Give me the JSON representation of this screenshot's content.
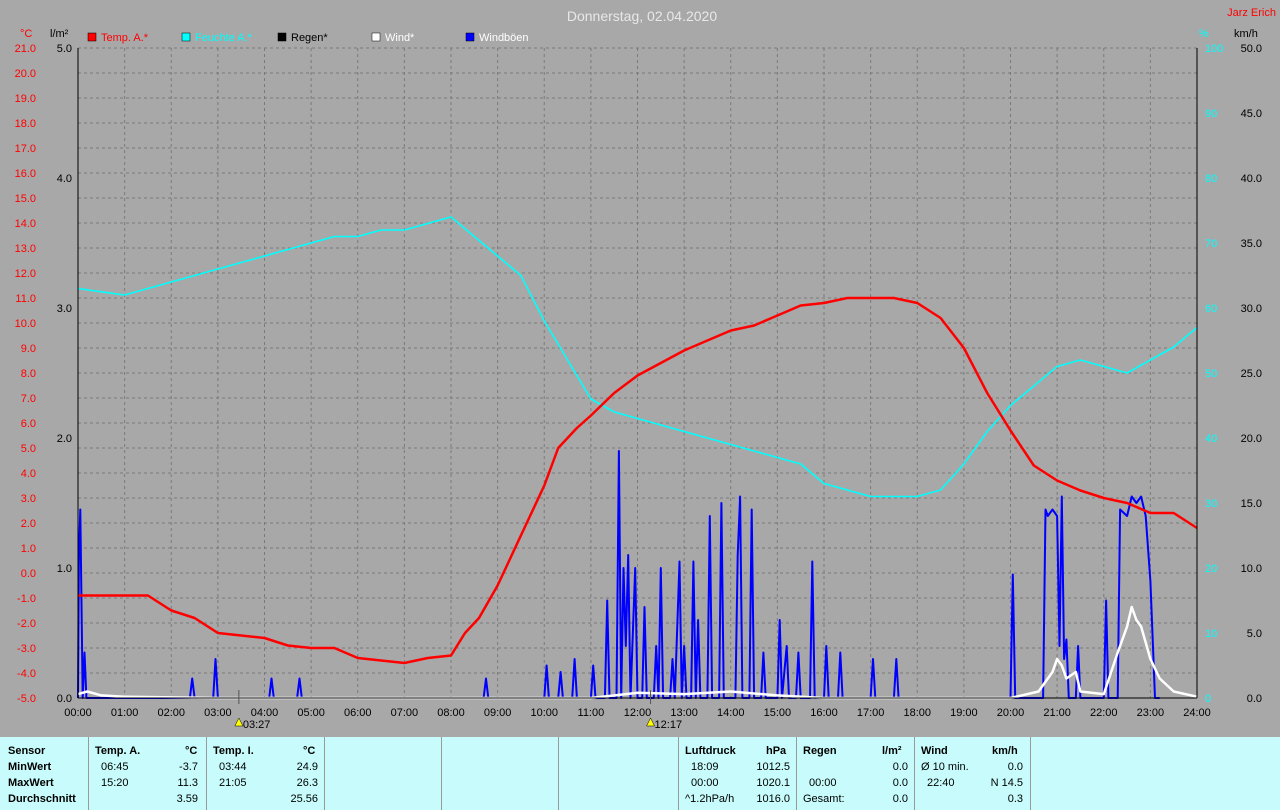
{
  "header": {
    "title": "Donnerstag, 02.04.2020",
    "author": "Jarz Erich"
  },
  "axes": {
    "left_temp_unit": "°C",
    "left_rain_unit": "l/m²",
    "right_pct_unit": "%",
    "right_wind_unit": "km/h"
  },
  "legend": [
    {
      "name": "Temp. A.*",
      "color": "#ff0000"
    },
    {
      "name": "Feuchte A.*",
      "color": "#00ffff"
    },
    {
      "name": "Regen*",
      "color": "#000000"
    },
    {
      "name": "Wind*",
      "color": "#ffffff"
    },
    {
      "name": "Windböen",
      "color": "#0000ff"
    }
  ],
  "chart_data": {
    "type": "line",
    "x_ticks": [
      "00:00",
      "01:00",
      "02:00",
      "03:00",
      "04:00",
      "05:00",
      "06:00",
      "07:00",
      "08:00",
      "09:00",
      "10:00",
      "11:00",
      "12:00",
      "13:00",
      "14:00",
      "15:00",
      "16:00",
      "17:00",
      "18:00",
      "19:00",
      "20:00",
      "21:00",
      "22:00",
      "23:00",
      "24:00"
    ],
    "temp_ticks": [
      "21.0",
      "20.0",
      "19.0",
      "18.0",
      "17.0",
      "16.0",
      "15.0",
      "14.0",
      "13.0",
      "12.0",
      "11.0",
      "10.0",
      "9.0",
      "8.0",
      "7.0",
      "6.0",
      "5.0",
      "4.0",
      "3.0",
      "2.0",
      "1.0",
      "0.0",
      "-1.0",
      "-2.0",
      "-3.0",
      "-4.0",
      "-5.0"
    ],
    "rain_ticks": [
      "5.0",
      "4.0",
      "3.0",
      "2.0",
      "1.0",
      "0.0"
    ],
    "pct_ticks": [
      "100",
      "90",
      "80",
      "70",
      "60",
      "50",
      "40",
      "30",
      "20",
      "10",
      "0"
    ],
    "wind_ticks": [
      "50.0",
      "45.0",
      "40.0",
      "35.0",
      "30.0",
      "25.0",
      "20.0",
      "15.0",
      "10.0",
      "5.0",
      "0.0"
    ],
    "ranges": {
      "temp": [
        -5,
        21
      ],
      "rain": [
        0,
        5
      ],
      "pct": [
        0,
        100
      ],
      "wind": [
        0,
        50
      ],
      "hours": [
        0,
        24
      ]
    },
    "markers": [
      {
        "label": "03:27",
        "hour": 3.45
      },
      {
        "label": "12:17",
        "hour": 12.28
      }
    ],
    "series": [
      {
        "name": "Temp. A.*",
        "color": "#ff0000",
        "axis": "temp",
        "points": [
          [
            0,
            -0.9
          ],
          [
            1,
            -0.9
          ],
          [
            1.5,
            -0.9
          ],
          [
            2,
            -1.5
          ],
          [
            2.5,
            -1.8
          ],
          [
            3,
            -2.4
          ],
          [
            3.5,
            -2.5
          ],
          [
            4,
            -2.6
          ],
          [
            4.5,
            -2.9
          ],
          [
            5,
            -3.0
          ],
          [
            5.5,
            -3.0
          ],
          [
            6,
            -3.4
          ],
          [
            6.5,
            -3.5
          ],
          [
            7,
            -3.6
          ],
          [
            7.5,
            -3.4
          ],
          [
            8,
            -3.3
          ],
          [
            8.3,
            -2.4
          ],
          [
            8.6,
            -1.8
          ],
          [
            9,
            -0.5
          ],
          [
            9.5,
            1.5
          ],
          [
            10,
            3.5
          ],
          [
            10.3,
            5.0
          ],
          [
            10.7,
            5.8
          ],
          [
            11,
            6.3
          ],
          [
            11.5,
            7.2
          ],
          [
            12,
            7.9
          ],
          [
            12.5,
            8.4
          ],
          [
            13,
            8.9
          ],
          [
            13.5,
            9.3
          ],
          [
            14,
            9.7
          ],
          [
            14.5,
            9.9
          ],
          [
            15,
            10.3
          ],
          [
            15.5,
            10.7
          ],
          [
            16,
            10.8
          ],
          [
            16.5,
            11.0
          ],
          [
            17,
            11.0
          ],
          [
            17.5,
            11.0
          ],
          [
            18,
            10.8
          ],
          [
            18.5,
            10.2
          ],
          [
            19,
            9.0
          ],
          [
            19.5,
            7.2
          ],
          [
            20,
            5.7
          ],
          [
            20.5,
            4.3
          ],
          [
            21,
            3.7
          ],
          [
            21.5,
            3.3
          ],
          [
            22,
            3.0
          ],
          [
            22.5,
            2.8
          ],
          [
            23,
            2.4
          ],
          [
            23.5,
            2.4
          ],
          [
            24,
            1.8
          ]
        ]
      },
      {
        "name": "Feuchte A.*",
        "color": "#00ffff",
        "axis": "pct",
        "points": [
          [
            0,
            63
          ],
          [
            0.5,
            62.5
          ],
          [
            1,
            62
          ],
          [
            1.5,
            63
          ],
          [
            2,
            64
          ],
          [
            2.5,
            65
          ],
          [
            3,
            66
          ],
          [
            3.5,
            67
          ],
          [
            4,
            68
          ],
          [
            4.5,
            69
          ],
          [
            5,
            70
          ],
          [
            5.5,
            71
          ],
          [
            6,
            71
          ],
          [
            6.5,
            72
          ],
          [
            7,
            72
          ],
          [
            7.5,
            73
          ],
          [
            8,
            74
          ],
          [
            8.5,
            71
          ],
          [
            9,
            68
          ],
          [
            9.5,
            65
          ],
          [
            10,
            58
          ],
          [
            10.5,
            52
          ],
          [
            11,
            46
          ],
          [
            11.5,
            44
          ],
          [
            12,
            43
          ],
          [
            12.5,
            42
          ],
          [
            13,
            41
          ],
          [
            13.5,
            40
          ],
          [
            14,
            39
          ],
          [
            14.5,
            38
          ],
          [
            15,
            37
          ],
          [
            15.5,
            36
          ],
          [
            16,
            33
          ],
          [
            16.5,
            32
          ],
          [
            17,
            31
          ],
          [
            17.5,
            31
          ],
          [
            18,
            31
          ],
          [
            18.5,
            32
          ],
          [
            19,
            36
          ],
          [
            19.5,
            41
          ],
          [
            20,
            45
          ],
          [
            20.5,
            48
          ],
          [
            21,
            51
          ],
          [
            21.5,
            52
          ],
          [
            22,
            51
          ],
          [
            22.5,
            50
          ],
          [
            23,
            52
          ],
          [
            23.5,
            54
          ],
          [
            24,
            57
          ]
        ]
      },
      {
        "name": "Windböen",
        "color": "#0000ff",
        "axis": "wind",
        "points": [
          [
            0,
            0
          ],
          [
            0.02,
            11
          ],
          [
            0.05,
            14.5
          ],
          [
            0.1,
            0
          ],
          [
            0.14,
            3.5
          ],
          [
            0.18,
            0
          ],
          [
            2.4,
            0
          ],
          [
            2.45,
            1.5
          ],
          [
            2.5,
            0
          ],
          [
            2.9,
            0
          ],
          [
            2.95,
            3
          ],
          [
            3.0,
            0
          ],
          [
            4.1,
            0
          ],
          [
            4.15,
            1.5
          ],
          [
            4.2,
            0
          ],
          [
            4.7,
            0
          ],
          [
            4.75,
            1.5
          ],
          [
            4.8,
            0
          ],
          [
            8.7,
            0
          ],
          [
            8.75,
            1.5
          ],
          [
            8.8,
            0
          ],
          [
            10.0,
            0
          ],
          [
            10.05,
            2.5
          ],
          [
            10.1,
            0
          ],
          [
            10.3,
            0
          ],
          [
            10.35,
            2
          ],
          [
            10.4,
            0
          ],
          [
            10.6,
            0
          ],
          [
            10.65,
            3
          ],
          [
            10.7,
            0
          ],
          [
            11.0,
            0
          ],
          [
            11.05,
            2.5
          ],
          [
            11.1,
            0
          ],
          [
            11.3,
            0
          ],
          [
            11.35,
            7.5
          ],
          [
            11.4,
            0
          ],
          [
            11.55,
            0
          ],
          [
            11.6,
            19
          ],
          [
            11.65,
            0
          ],
          [
            11.7,
            10
          ],
          [
            11.75,
            4
          ],
          [
            11.8,
            11
          ],
          [
            11.85,
            0
          ],
          [
            11.95,
            10
          ],
          [
            12.0,
            0
          ],
          [
            12.1,
            0
          ],
          [
            12.15,
            7
          ],
          [
            12.2,
            0
          ],
          [
            12.35,
            0
          ],
          [
            12.4,
            4
          ],
          [
            12.45,
            0
          ],
          [
            12.5,
            10
          ],
          [
            12.55,
            0
          ],
          [
            12.7,
            0
          ],
          [
            12.75,
            3
          ],
          [
            12.8,
            0
          ],
          [
            12.9,
            10.5
          ],
          [
            12.95,
            0
          ],
          [
            13.0,
            4
          ],
          [
            13.05,
            0
          ],
          [
            13.15,
            0
          ],
          [
            13.2,
            10.5
          ],
          [
            13.25,
            0
          ],
          [
            13.3,
            6
          ],
          [
            13.35,
            0
          ],
          [
            13.5,
            0
          ],
          [
            13.55,
            14
          ],
          [
            13.6,
            0
          ],
          [
            13.75,
            0
          ],
          [
            13.8,
            15
          ],
          [
            13.85,
            0
          ],
          [
            14.1,
            0
          ],
          [
            14.15,
            11
          ],
          [
            14.2,
            15.5
          ],
          [
            14.25,
            0
          ],
          [
            14.4,
            0
          ],
          [
            14.45,
            14.5
          ],
          [
            14.5,
            0
          ],
          [
            14.65,
            0
          ],
          [
            14.7,
            3.5
          ],
          [
            14.75,
            0
          ],
          [
            15.0,
            0
          ],
          [
            15.05,
            6
          ],
          [
            15.1,
            0
          ],
          [
            15.2,
            4
          ],
          [
            15.25,
            0
          ],
          [
            15.4,
            0
          ],
          [
            15.45,
            3.5
          ],
          [
            15.5,
            0
          ],
          [
            15.7,
            0
          ],
          [
            15.75,
            10.5
          ],
          [
            15.8,
            0
          ],
          [
            16.0,
            0
          ],
          [
            16.05,
            4
          ],
          [
            16.1,
            0
          ],
          [
            16.3,
            0
          ],
          [
            16.35,
            3.5
          ],
          [
            16.4,
            0
          ],
          [
            17.0,
            0
          ],
          [
            17.05,
            3
          ],
          [
            17.1,
            0
          ],
          [
            17.5,
            0
          ],
          [
            17.55,
            3
          ],
          [
            17.6,
            0
          ],
          [
            20.0,
            0
          ],
          [
            20.05,
            9.5
          ],
          [
            20.1,
            0
          ],
          [
            20.7,
            0
          ],
          [
            20.75,
            14.5
          ],
          [
            20.8,
            14
          ],
          [
            20.9,
            14.5
          ],
          [
            21.0,
            14
          ],
          [
            21.05,
            4
          ],
          [
            21.1,
            15.5
          ],
          [
            21.15,
            3
          ],
          [
            21.2,
            4.5
          ],
          [
            21.25,
            0
          ],
          [
            21.4,
            0
          ],
          [
            21.45,
            4
          ],
          [
            21.5,
            0
          ],
          [
            22.0,
            0
          ],
          [
            22.05,
            7.5
          ],
          [
            22.1,
            0
          ],
          [
            22.3,
            0
          ],
          [
            22.35,
            14.5
          ],
          [
            22.5,
            14
          ],
          [
            22.6,
            15.5
          ],
          [
            22.7,
            15
          ],
          [
            22.8,
            15.5
          ],
          [
            22.9,
            14
          ],
          [
            23.0,
            9
          ],
          [
            23.1,
            0
          ],
          [
            23.2,
            0
          ]
        ]
      },
      {
        "name": "Wind*",
        "color": "#ffffff",
        "axis": "wind",
        "points": [
          [
            0,
            0.3
          ],
          [
            0.2,
            0.5
          ],
          [
            0.5,
            0.2
          ],
          [
            1,
            0.1
          ],
          [
            3,
            0
          ],
          [
            11,
            0
          ],
          [
            12,
            0.4
          ],
          [
            13,
            0.3
          ],
          [
            14,
            0.5
          ],
          [
            15,
            0.2
          ],
          [
            16,
            0
          ],
          [
            20,
            0
          ],
          [
            20.6,
            0.5
          ],
          [
            20.9,
            2
          ],
          [
            21.0,
            3
          ],
          [
            21.1,
            2.5
          ],
          [
            21.2,
            1.5
          ],
          [
            21.4,
            2
          ],
          [
            21.5,
            0.5
          ],
          [
            22.0,
            0.3
          ],
          [
            22.3,
            3.5
          ],
          [
            22.5,
            5.5
          ],
          [
            22.6,
            7
          ],
          [
            22.7,
            6
          ],
          [
            22.8,
            5.5
          ],
          [
            23.0,
            3
          ],
          [
            23.2,
            1.5
          ],
          [
            23.5,
            0.5
          ],
          [
            24,
            0.1
          ]
        ]
      },
      {
        "name": "Regen*",
        "color": "#000000",
        "axis": "rain",
        "points": [
          [
            0,
            0
          ],
          [
            24,
            0
          ]
        ]
      }
    ]
  },
  "stats": {
    "sensor": {
      "title": "Sensor",
      "min": "MinWert",
      "max": "MaxWert",
      "avg": "Durchschnitt"
    },
    "temp_a": {
      "title": "Temp. A.",
      "unit": "°C",
      "min_time": "06:45",
      "min_val": "-3.7",
      "max_time": "15:20",
      "max_val": "11.3",
      "avg": "3.59"
    },
    "temp_i": {
      "title": "Temp. I.",
      "unit": "°C",
      "min_time": "03:44",
      "min_val": "24.9",
      "max_time": "21:05",
      "max_val": "26.3",
      "avg": "25.56"
    },
    "pressure": {
      "title": "Luftdruck",
      "unit": "hPa",
      "min_time": "18:09",
      "min_val": "1012.5",
      "max_time": "00:00",
      "max_val": "1020.1",
      "avg_label": "^1.2hPa/h",
      "avg": "1016.0"
    },
    "rain": {
      "title": "Regen",
      "unit": "l/m²",
      "min_val": "0.0",
      "max_time": "00:00",
      "max_val": "0.0",
      "avg_label": "Gesamt:",
      "avg": "0.0"
    },
    "wind": {
      "title": "Wind",
      "unit": "km/h",
      "min_label": "Ø 10 min.",
      "min_val": "0.0",
      "max_time": "22:40",
      "max_val": "N 14.5",
      "avg": "0.3"
    }
  }
}
